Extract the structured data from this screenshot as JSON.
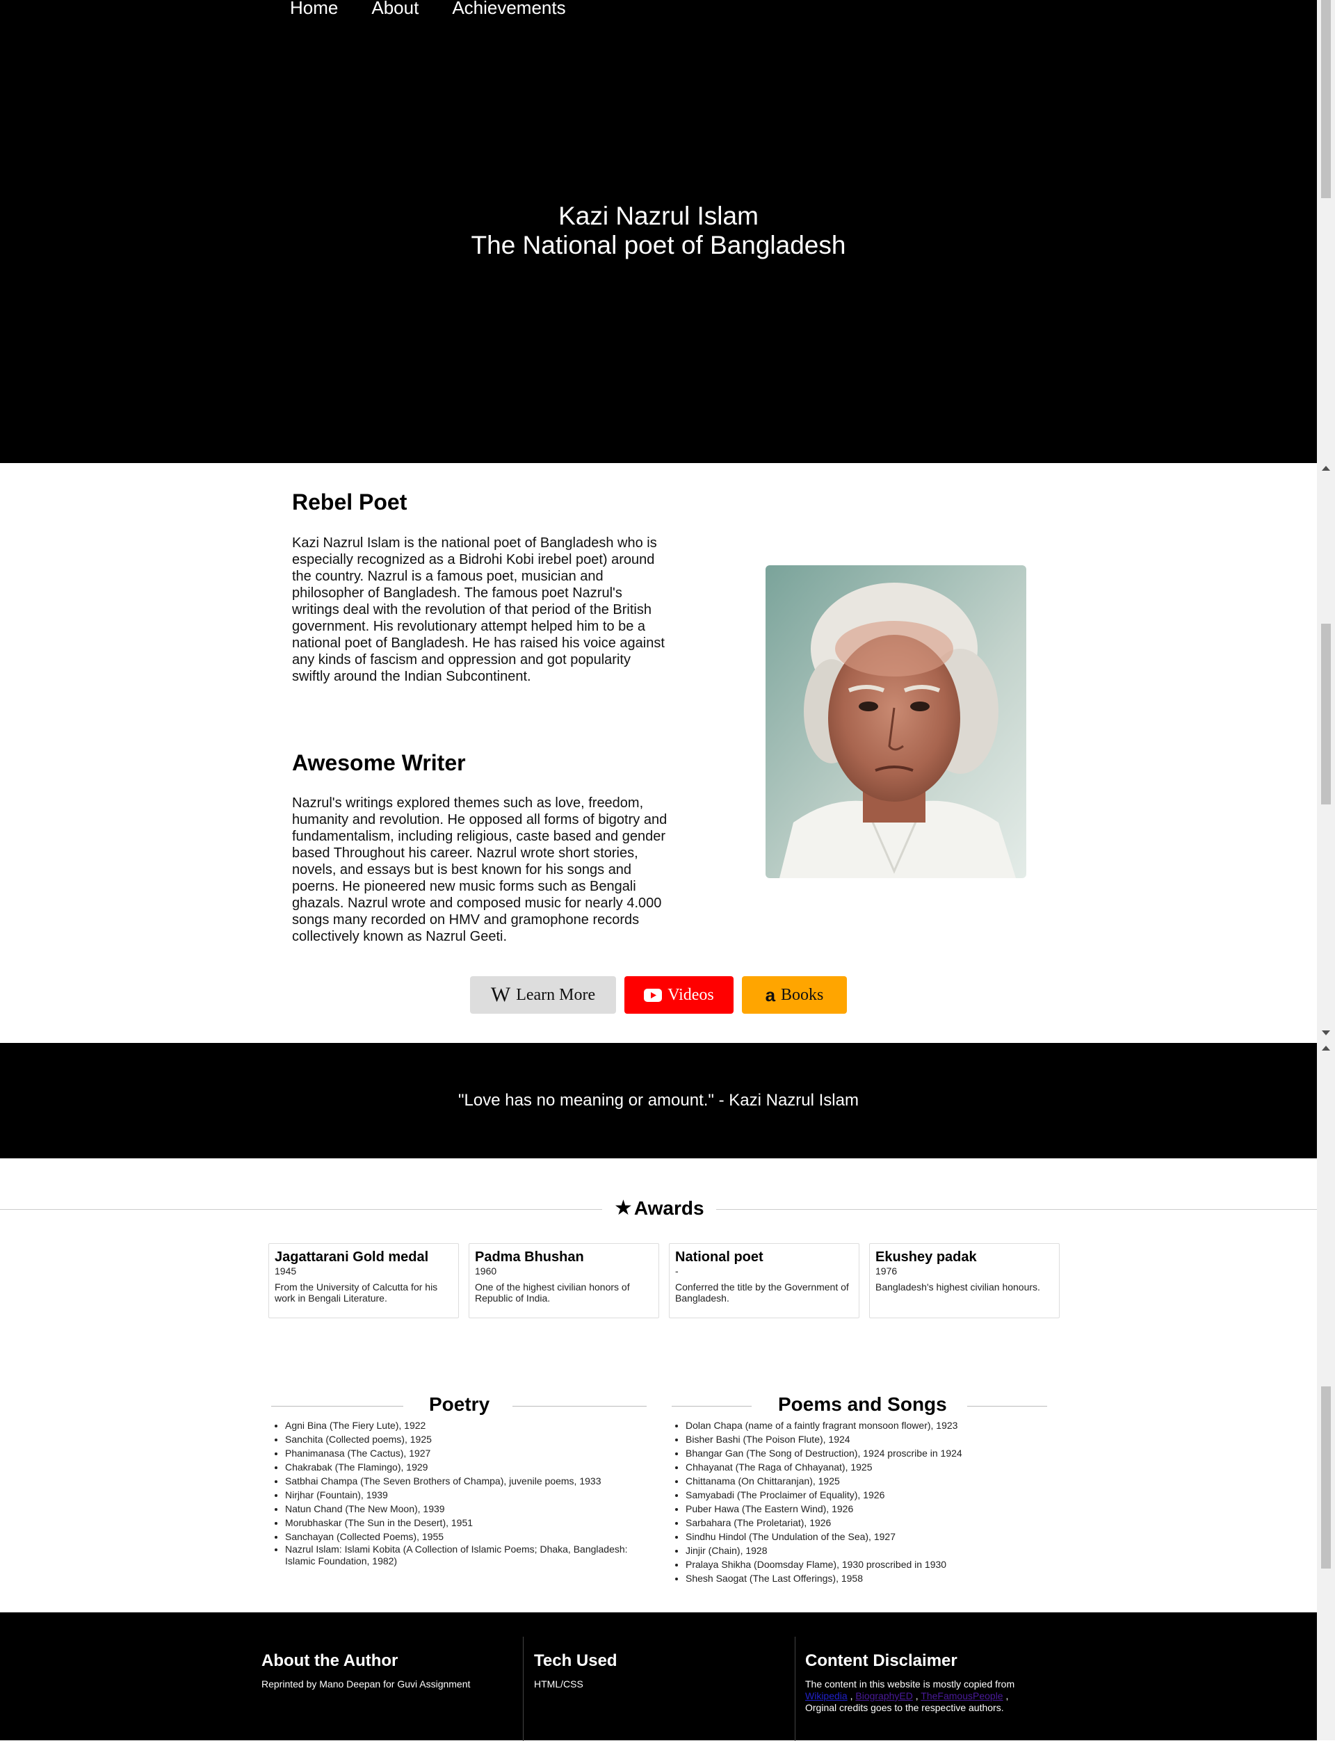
{
  "nav": {
    "items": [
      "Home",
      "About",
      "Achievements"
    ]
  },
  "hero": {
    "title_line1": "Kazi Nazrul Islam",
    "title_line2": "The National poet of Bangladesh"
  },
  "bio": {
    "section1_title": "Rebel Poet",
    "section1_text": "Kazi Nazrul Islam is the national poet of Bangladesh who is especially recognized as a Bidrohi Kobi irebel poet) around the country. Nazrul is a famous poet, musician and philosopher of Bangladesh. The famous poet Nazrul's writings deal with the revolution of that period of the British government. His revolutionary attempt helped him to be a national poet of Bangladesh. He has raised his voice against any kinds of fascism and oppression and got popularity swiftly around the Indian Subcontinent.",
    "section2_title": "Awesome Writer",
    "section2_text": "Nazrul's writings explored themes such as love, freedom, humanity and revolution. He opposed all forms of bigotry and fundamentalism, including religious, caste based and gender based Throughout his career. Nazrul wrote short stories, novels, and essays but is best known for his songs and poerns. He pioneered new music forms such as Bengali ghazals. Nazrul wrote and composed music for nearly 4.000 songs many recorded on HMV and gramophone records collectively known as Nazrul Geeti."
  },
  "buttons": {
    "learn_more": "Learn More",
    "videos": "Videos",
    "books": "Books"
  },
  "quote": {
    "text": "\"Love has no meaning or amount.\" - Kazi Nazrul Islam"
  },
  "awards": {
    "heading": "Awards",
    "items": [
      {
        "title": "Jagattarani Gold medal",
        "year": "1945",
        "desc": "From the University of Calcutta for his work in Bengali Literature."
      },
      {
        "title": "Padma Bhushan",
        "year": "1960",
        "desc": "One of the highest civilian honors of Republic of India."
      },
      {
        "title": "National poet",
        "year": "-",
        "desc": "Conferred the title by the Government of Bangladesh."
      },
      {
        "title": "Ekushey padak",
        "year": "1976",
        "desc": "Bangladesh's highest civilian honours."
      }
    ]
  },
  "poetry": {
    "heading": "Poetry",
    "items": [
      "Agni Bina (The Fiery Lute), 1922",
      "Sanchita (Collected poems), 1925",
      "Phanimanasa (The Cactus), 1927",
      "Chakrabak (The Flamingo), 1929",
      "Satbhai Champa (The Seven Brothers of Champa), juvenile poems, 1933",
      "Nirjhar (Fountain), 1939",
      "Natun Chand (The New Moon), 1939",
      "Morubhaskar (The Sun in the Desert), 1951",
      "Sanchayan (Collected Poems), 1955",
      "Nazrul Islam: Islami Kobita (A Collection of Islamic Poems; Dhaka, Bangladesh: Islamic Foundation, 1982)"
    ]
  },
  "songs": {
    "heading": "Poems and Songs",
    "items": [
      "Dolan Chapa (name of a faintly fragrant monsoon flower), 1923",
      "Bisher Bashi (The Poison Flute), 1924",
      "Bhangar Gan (The Song of Destruction), 1924 proscribe in 1924",
      "Chhayanat (The Raga of Chhayanat), 1925",
      "Chittanama (On Chittaranjan), 1925",
      "Samyabadi (The Proclaimer of Equality), 1926",
      "Puber Hawa (The Eastern Wind), 1926",
      "Sarbahara (The Proletariat), 1926",
      "Sindhu Hindol (The Undulation of the Sea), 1927",
      "Jinjir (Chain), 1928",
      "Pralaya Shikha (Doomsday Flame), 1930 proscribed in 1930",
      "Shesh Saogat (The Last Offerings), 1958"
    ]
  },
  "footer": {
    "about_title": "About the Author",
    "about_text": "Reprinted by Mano Deepan for Guvi Assignment",
    "tech_title": "Tech Used",
    "tech_text": "HTML/CSS",
    "disclaimer_title": "Content Disclaimer",
    "disclaimer_text1": "The content in this website is mostly copied from",
    "link1": "Wikipedia",
    "link2": "BiographyED",
    "link3": "TheFamousPeople",
    "disclaimer_text2": "Orginal credits goes to the respective authors."
  },
  "colors": {
    "video_red": "#ff0000",
    "books_orange": "#ffa500",
    "learn_gray": "#dddddd",
    "link_blue": "#2121c9",
    "link_purple": "#4a1b9a"
  }
}
